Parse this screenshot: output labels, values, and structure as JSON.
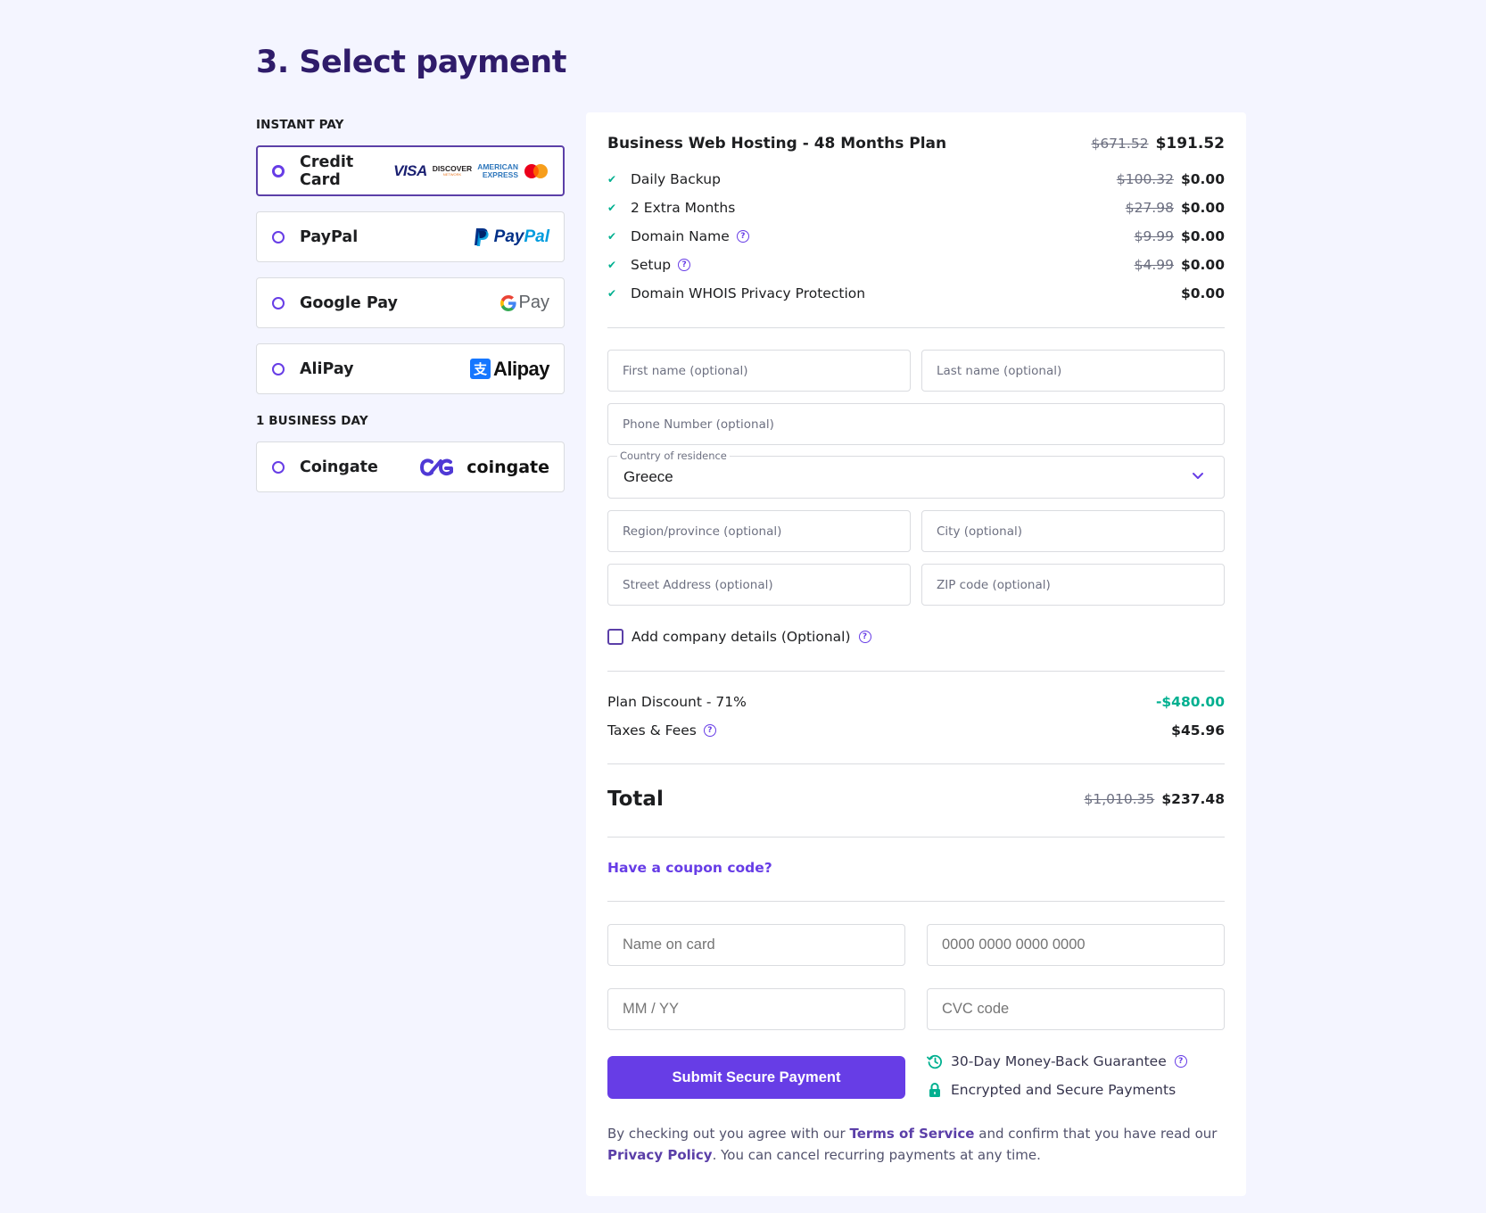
{
  "page": {
    "title": "3. Select payment"
  },
  "payment_methods": {
    "instant_label": "INSTANT PAY",
    "delayed_label": "1 BUSINESS DAY",
    "options": [
      {
        "label": "Credit Card",
        "selected": true,
        "logos": [
          "VISA",
          "DISCOVER",
          "AMERICAN EXPRESS",
          "mastercard"
        ]
      },
      {
        "label": "PayPal",
        "selected": false,
        "logo_text_a": "Pay",
        "logo_text_b": "Pal"
      },
      {
        "label": "Google Pay",
        "selected": false,
        "logo_text": "Pay"
      },
      {
        "label": "AliPay",
        "selected": false,
        "logo_text": "Alipay"
      },
      {
        "label": "Coingate",
        "selected": false,
        "logo_text": "coingate"
      }
    ],
    "logo_text": {
      "visa": "VISA",
      "discover": "DISCOVER",
      "discover_sub": "NETWORK",
      "amex_1": "AMERICAN",
      "amex_2": "EXPRESS",
      "alipay_glyph": "支"
    }
  },
  "order": {
    "plan": {
      "name": "Business Web Hosting - 48 Months Plan",
      "old_price": "$671.52",
      "price": "$191.52"
    },
    "items": [
      {
        "label": "Daily Backup",
        "old_price": "$100.32",
        "price": "$0.00",
        "help": false
      },
      {
        "label": "2 Extra Months",
        "old_price": "$27.98",
        "price": "$0.00",
        "help": false
      },
      {
        "label": "Domain Name",
        "old_price": "$9.99",
        "price": "$0.00",
        "help": true
      },
      {
        "label": "Setup",
        "old_price": "$4.99",
        "price": "$0.00",
        "help": true
      },
      {
        "label": "Domain WHOIS Privacy Protection",
        "old_price": "",
        "price": "$0.00",
        "help": false
      }
    ],
    "discount": {
      "label": "Plan Discount - 71%",
      "value": "-$480.00"
    },
    "taxes": {
      "label": "Taxes & Fees",
      "value": "$45.96"
    },
    "total": {
      "label": "Total",
      "old_price": "$1,010.35",
      "price": "$237.48"
    },
    "coupon_link": "Have a coupon code?"
  },
  "billing_form": {
    "first_name": {
      "placeholder": "First name (optional)",
      "value": ""
    },
    "last_name": {
      "placeholder": "Last name (optional)",
      "value": ""
    },
    "phone": {
      "placeholder": "Phone Number (optional)",
      "value": ""
    },
    "country": {
      "label": "Country of residence",
      "value": "Greece"
    },
    "region": {
      "placeholder": "Region/province (optional)",
      "value": ""
    },
    "city": {
      "placeholder": "City (optional)",
      "value": ""
    },
    "street": {
      "placeholder": "Street Address (optional)",
      "value": ""
    },
    "zip": {
      "placeholder": "ZIP code (optional)",
      "value": ""
    },
    "company_checkbox": {
      "label": "Add company details (Optional)",
      "checked": false
    }
  },
  "card_form": {
    "name": {
      "placeholder": "Name on card",
      "value": ""
    },
    "number": {
      "placeholder": "0000 0000 0000 0000",
      "value": ""
    },
    "expiry": {
      "placeholder": "MM / YY",
      "value": ""
    },
    "cvc": {
      "placeholder": "CVC code",
      "value": ""
    },
    "submit_label": "Submit Secure Payment"
  },
  "assurances": [
    {
      "icon": "history-icon",
      "label": "30-Day Money-Back Guarantee",
      "help": true
    },
    {
      "icon": "lock-icon",
      "label": "Encrypted and Secure Payments",
      "help": false
    }
  ],
  "legal": {
    "part1": "By checking out you agree with our ",
    "terms_link": "Terms of Service",
    "part2": " and confirm that you have read our ",
    "privacy_link": "Privacy Policy",
    "part3": ". You can cancel recurring payments at any time."
  },
  "colors": {
    "primary": "#673de6",
    "title": "#2f1c6a",
    "success": "#00b090",
    "background": "#f4f5ff"
  }
}
